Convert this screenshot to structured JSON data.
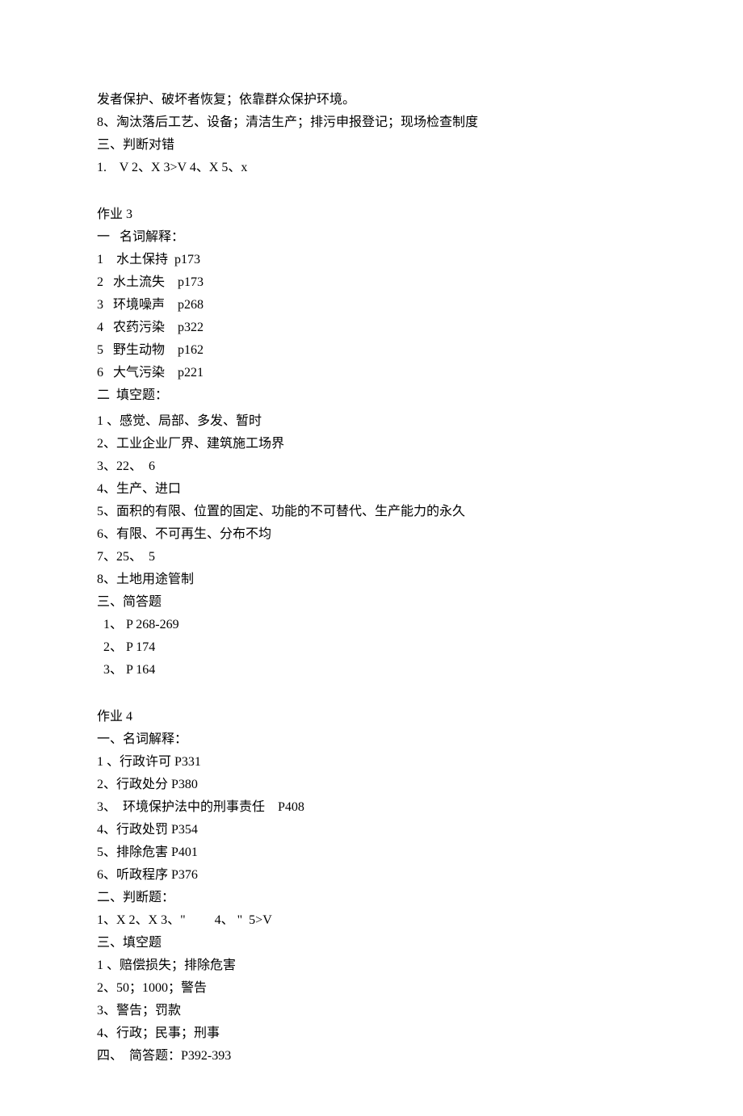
{
  "lines": {
    "top1": "发者保护、破坏者恢复；依靠群众保护环境。",
    "top2": "8、淘汰落后工艺、设备；清洁生产；排污申报登记；现场检查制度",
    "top3": "三、判断对错",
    "top4": "1.    V 2、X 3>V 4、X 5、x",
    "a3_title": "作业 3",
    "a3_s1_head": "一   名词解释：",
    "a3_s1_1": "1    水土保持  p173",
    "a3_s1_2": "2   水土流失    p173",
    "a3_s1_3": "3   环境噪声    p268",
    "a3_s1_4": "4   农药污染    p322",
    "a3_s1_5": "5   野生动物    p162",
    "a3_s1_6": "6   大气污染    p221",
    "a3_s2_head": "二  填空题：",
    "a3_s2_1": "1 、感觉、局部、多发、暂时",
    "a3_s2_2": "2、工业企业厂界、建筑施工场界",
    "a3_s2_3": "3、22、  6",
    "a3_s2_4": "4、生产、进口",
    "a3_s2_5": "5、面积的有限、位置的固定、功能的不可替代、生产能力的永久",
    "a3_s2_6": "6、有限、不可再生、分布不均",
    "a3_s2_7": "7、25、  5",
    "a3_s2_8": "8、土地用途管制",
    "a3_s3_head": "三、简答题",
    "a3_s3_1": "  1、 P 268-269",
    "a3_s3_2": "  2、 P 174",
    "a3_s3_3": "  3、 P 164",
    "a4_title": "作业 4",
    "a4_s1_head": "一、名词解释：",
    "a4_s1_1": "1 、行政许可 P331",
    "a4_s1_2": "2、行政处分 P380",
    "a4_s1_3": "3、  环境保护法中的刑事责任    P408",
    "a4_s1_4": "4、行政处罚 P354",
    "a4_s1_5": "5、排除危害 P401",
    "a4_s1_6": "6、听政程序 P376",
    "a4_s2_head": "二、判断题：",
    "a4_s2_1": "1、X 2、X 3、\"         4、 \"  5>V",
    "a4_s3_head": "三、填空题",
    "a4_s3_1": "1 、赔偿损失；排除危害",
    "a4_s3_2": "2、50；1000；警告",
    "a4_s3_3": "3、警告；罚款",
    "a4_s3_4": "4、行政；民事；刑事",
    "a4_s4_head": "四、  简答题：P392-393"
  }
}
